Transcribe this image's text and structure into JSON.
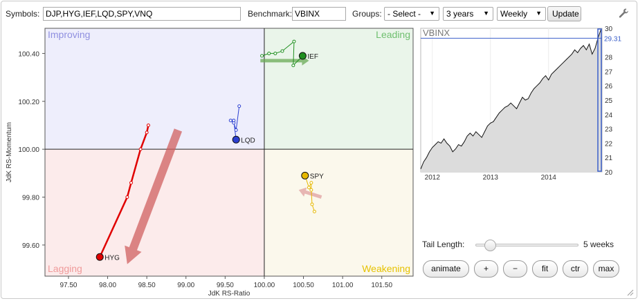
{
  "toolbar": {
    "symbols_label": "Symbols:",
    "symbols_value": "DJP,HYG,IEF,LQD,SPY,VNQ",
    "benchmark_label": "Benchmark:",
    "benchmark_value": "VBINX",
    "groups_label": "Groups:",
    "groups_selected": "- Select -",
    "period_selected": "3 years",
    "interval_selected": "Weekly",
    "update_label": "Update",
    "settings_icon": "wrench-icon"
  },
  "rrg": {
    "ylabel": "JdK RS-Momentum",
    "xlabel": "JdK RS-Ratio",
    "xlim": [
      97.2,
      101.9
    ],
    "ylim": [
      99.47,
      100.505
    ],
    "x_ticks": [
      97.5,
      98.0,
      98.5,
      99.0,
      99.5,
      100.0,
      100.5,
      101.0,
      101.5
    ],
    "x_tick_labels": [
      "97.50",
      "98.00",
      "98.50",
      "99.00",
      "99.50",
      "100.00",
      "100.50",
      "101.00",
      "101.50"
    ],
    "y_ticks": [
      99.6,
      99.8,
      100.0,
      100.2,
      100.4
    ],
    "y_tick_labels": [
      "99.60",
      "99.80",
      "100.00",
      "100.20",
      "100.40"
    ],
    "quadrants": {
      "improving": {
        "label": "Improving",
        "color": "#8f8fe0",
        "fill": "#eeeefc"
      },
      "leading": {
        "label": "Leading",
        "color": "#6fbf6f",
        "fill": "#eaf5ea"
      },
      "lagging": {
        "label": "Lagging",
        "color": "#ef9a9a",
        "fill": "#fcebeb"
      },
      "weakening": {
        "label": "Weakening",
        "color": "#e6c200",
        "fill": "#fbf8ec"
      }
    }
  },
  "chart_data": [
    {
      "type": "scatter",
      "xlabel": "JdK RS-Ratio",
      "ylabel": "JdK RS-Momentum",
      "xlim": [
        97.2,
        101.9
      ],
      "ylim": [
        99.47,
        100.505
      ],
      "grid": false,
      "series": [
        {
          "name": "IEF",
          "color": "#1f8f1f",
          "points": [
            [
              99.97,
              100.39
            ],
            [
              100.06,
              100.4
            ],
            [
              100.14,
              100.4
            ],
            [
              100.23,
              100.41
            ],
            [
              100.38,
              100.45
            ],
            [
              100.37,
              100.35
            ],
            [
              100.49,
              100.39
            ]
          ]
        },
        {
          "name": "LQD",
          "color": "#2b3fd1",
          "points": [
            [
              99.68,
              100.18
            ],
            [
              99.64,
              100.08
            ],
            [
              99.61,
              100.11
            ],
            [
              99.57,
              100.12
            ],
            [
              99.61,
              100.12
            ],
            [
              99.64,
              100.04
            ]
          ]
        },
        {
          "name": "SPY",
          "color": "#e6b800",
          "points": [
            [
              100.64,
              99.74
            ],
            [
              100.61,
              99.77
            ],
            [
              100.6,
              99.83
            ],
            [
              100.6,
              99.86
            ],
            [
              100.57,
              99.84
            ],
            [
              100.52,
              99.89
            ]
          ]
        },
        {
          "name": "HYG",
          "color": "#e00000",
          "points": [
            [
              98.52,
              100.1
            ],
            [
              98.5,
              100.07
            ],
            [
              98.42,
              100.0
            ],
            [
              98.3,
              99.86
            ],
            [
              98.25,
              99.8
            ],
            [
              97.9,
              99.55
            ]
          ]
        }
      ],
      "arrows": [
        {
          "from": [
            99.95,
            100.37
          ],
          "to": [
            100.57,
            100.37
          ],
          "color": "#6aaa55"
        },
        {
          "from": [
            100.73,
            99.8
          ],
          "to": [
            100.44,
            99.83
          ],
          "color": "#e0a0a0"
        },
        {
          "from": [
            98.9,
            100.08
          ],
          "to": [
            98.25,
            99.52
          ],
          "color": "#d06060"
        }
      ]
    },
    {
      "type": "area",
      "title": "VBINX",
      "x_tick_labels": [
        "2012",
        "2013",
        "2014"
      ],
      "y_ticks": [
        20,
        21,
        22,
        23,
        24,
        25,
        26,
        27,
        28,
        29,
        30
      ],
      "ylim": [
        20,
        30
      ],
      "last_value_label": "29.31",
      "x": [
        2011.8,
        2011.85,
        2011.9,
        2011.95,
        2012.0,
        2012.05,
        2012.1,
        2012.15,
        2012.2,
        2012.25,
        2012.3,
        2012.35,
        2012.4,
        2012.45,
        2012.5,
        2012.55,
        2012.6,
        2012.65,
        2012.7,
        2012.75,
        2012.8,
        2012.85,
        2012.9,
        2012.95,
        2013.0,
        2013.05,
        2013.1,
        2013.15,
        2013.2,
        2013.25,
        2013.3,
        2013.35,
        2013.4,
        2013.45,
        2013.5,
        2013.55,
        2013.6,
        2013.65,
        2013.7,
        2013.75,
        2013.8,
        2013.85,
        2013.9,
        2013.95,
        2014.0,
        2014.05,
        2014.1,
        2014.15,
        2014.2,
        2014.25,
        2014.3,
        2014.35,
        2014.4,
        2014.45,
        2014.5,
        2014.55,
        2014.6,
        2014.65,
        2014.7,
        2014.75,
        2014.8,
        2014.85,
        2014.9
      ],
      "values": [
        20.2,
        20.7,
        21.0,
        21.4,
        21.7,
        21.9,
        22.1,
        22.0,
        22.3,
        22.0,
        21.8,
        21.4,
        21.6,
        21.9,
        21.8,
        22.1,
        22.5,
        22.7,
        22.5,
        22.8,
        22.6,
        22.4,
        22.8,
        23.2,
        23.4,
        23.5,
        23.8,
        24.1,
        24.3,
        24.5,
        24.6,
        24.8,
        24.6,
        24.4,
        24.8,
        25.2,
        25.0,
        25.1,
        25.5,
        25.8,
        26.0,
        26.2,
        26.5,
        26.7,
        26.4,
        26.8,
        27.0,
        27.2,
        27.4,
        27.6,
        27.8,
        28.0,
        28.2,
        28.5,
        28.3,
        28.6,
        28.8,
        28.5,
        28.9,
        28.2,
        28.6,
        29.31,
        29.9
      ]
    }
  ],
  "tail": {
    "label": "Tail Length:",
    "value": 5,
    "min": 1,
    "max": 30,
    "value_label": "5 weeks"
  },
  "controls": {
    "animate": "animate",
    "plus": "+",
    "minus": "−",
    "fit": "fit",
    "ctr": "ctr",
    "max": "max"
  }
}
